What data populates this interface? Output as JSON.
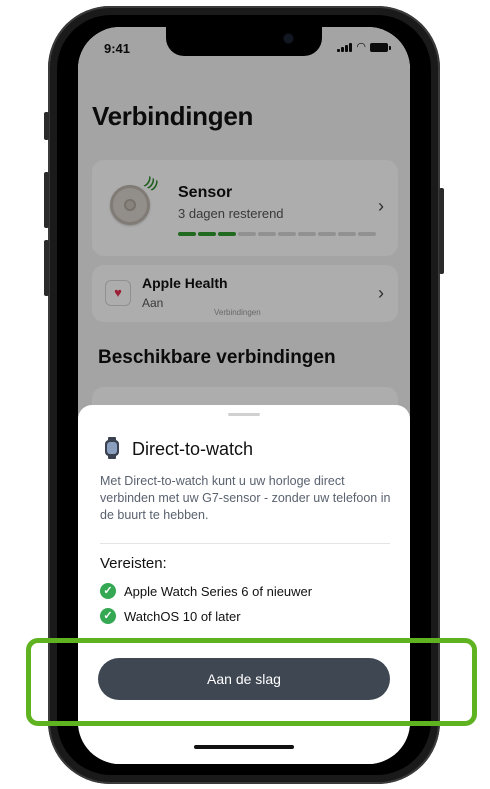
{
  "status_bar": {
    "time": "9:41"
  },
  "header": {
    "title": "Verbindingen"
  },
  "sensor_card": {
    "name": "Sensor",
    "subtitle": "3 dagen resterend",
    "progress_filled": 3,
    "progress_total": 10,
    "accent": "#2e9d2e"
  },
  "health_card": {
    "name": "Apple Health",
    "status": "Aan",
    "overlay_label": "Verbindingen"
  },
  "section": {
    "title": "Beschikbare verbindingen"
  },
  "sheet": {
    "title": "Direct-to-watch",
    "description": "Met Direct-to-watch kunt u uw horloge direct verbinden met uw G7-sensor - zonder uw telefoon in de buurt te hebben.",
    "requirements_title": "Vereisten:",
    "requirements": [
      "Apple Watch Series 6 of nieuwer",
      "WatchOS 10 of later"
    ],
    "cta_label": "Aan de slag"
  },
  "colors": {
    "highlight": "#5fb320",
    "check": "#34a853",
    "button": "#3f4753"
  },
  "icons": {
    "sensor": "sensor-icon",
    "health": "heart-icon",
    "watch": "watch-icon",
    "check": "check-circle-icon",
    "chevron": "chevron-right-icon"
  }
}
